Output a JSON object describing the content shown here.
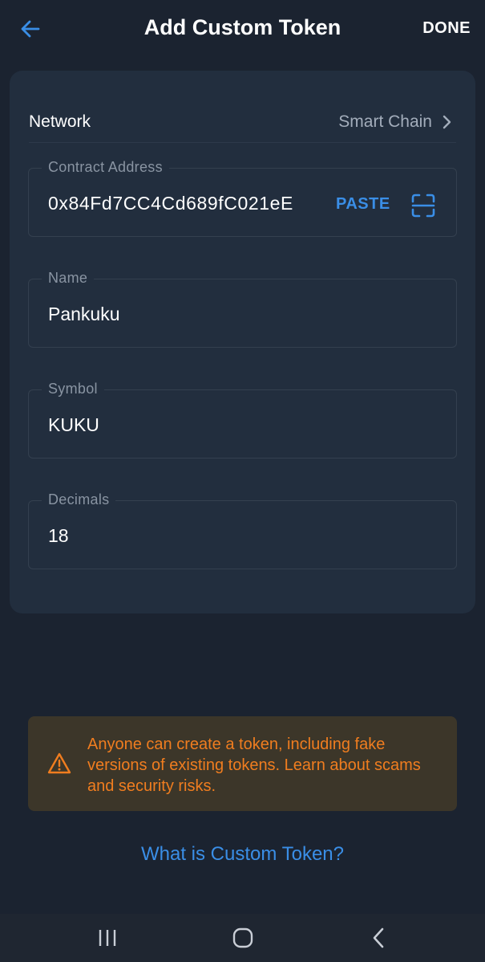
{
  "header": {
    "title": "Add Custom Token",
    "done_label": "DONE",
    "back_icon": "arrow-left-icon"
  },
  "network": {
    "label": "Network",
    "value": "Smart Chain"
  },
  "fields": {
    "contract_address": {
      "label": "Contract Address",
      "value": "0x84Fd7CC4Cd689fC021eE",
      "paste_label": "PASTE",
      "scan_icon": "qr-scan-icon"
    },
    "name": {
      "label": "Name",
      "value": "Pankuku"
    },
    "symbol": {
      "label": "Symbol",
      "value": "KUKU"
    },
    "decimals": {
      "label": "Decimals",
      "value": "18"
    }
  },
  "warning": {
    "icon": "warning-triangle-icon",
    "text": "Anyone can create a token, including fake versions of existing tokens. Learn about scams and security risks."
  },
  "help_link": "What is Custom Token?",
  "colors": {
    "background": "#1b2330",
    "card": "#222e3e",
    "accent_blue": "#3a8ee6",
    "warning_orange": "#f07d1f",
    "warning_bg": "#3c3629"
  },
  "system_nav": {
    "recents_icon": "recents-icon",
    "home_icon": "home-icon",
    "back_icon": "back-chevron-icon"
  }
}
